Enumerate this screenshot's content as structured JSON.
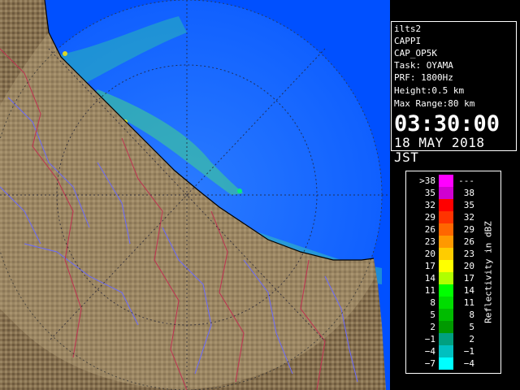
{
  "info": {
    "station": "ilts2",
    "product": "CAPPI",
    "product_code": "CAP_OP5K",
    "task": "Task: OYAMA",
    "prf": "PRF: 1800Hz",
    "height": "Height:0.5 km",
    "max_range": "Max Range:80 km",
    "time": "03:30:00",
    "date": "18 MAY 2018 JST"
  },
  "legend": {
    "title": "Reflectivity in dBZ",
    "rows": [
      {
        "left": ">38",
        "right": "---",
        "color": "#ff00ff"
      },
      {
        "left": "35",
        "right": "38",
        "color": "#d000d0"
      },
      {
        "left": "32",
        "right": "35",
        "color": "#ff0000"
      },
      {
        "left": "29",
        "right": "32",
        "color": "#ff3300"
      },
      {
        "left": "26",
        "right": "29",
        "color": "#ff6600"
      },
      {
        "left": "23",
        "right": "26",
        "color": "#ff9900"
      },
      {
        "left": "20",
        "right": "23",
        "color": "#ffcc00"
      },
      {
        "left": "17",
        "right": "20",
        "color": "#ffff00"
      },
      {
        "left": "14",
        "right": "17",
        "color": "#b0ff00"
      },
      {
        "left": "11",
        "right": "14",
        "color": "#00ff00"
      },
      {
        "left": "8",
        "right": "11",
        "color": "#00dd00"
      },
      {
        "left": "5",
        "right": "8",
        "color": "#00bb00"
      },
      {
        "left": "2",
        "right": "5",
        "color": "#009900"
      },
      {
        "left": "−1",
        "right": "2",
        "color": "#00a080"
      },
      {
        "left": "−4",
        "right": "−1",
        "color": "#00c0c0"
      },
      {
        "left": "−7",
        "right": "−4",
        "color": "#00ffff"
      }
    ]
  },
  "colors": {
    "sea": "#0050ff",
    "radar_range": "#1a6bff",
    "land": "#8a7558",
    "river": "#6a6aff",
    "boundary": "#c03050"
  }
}
